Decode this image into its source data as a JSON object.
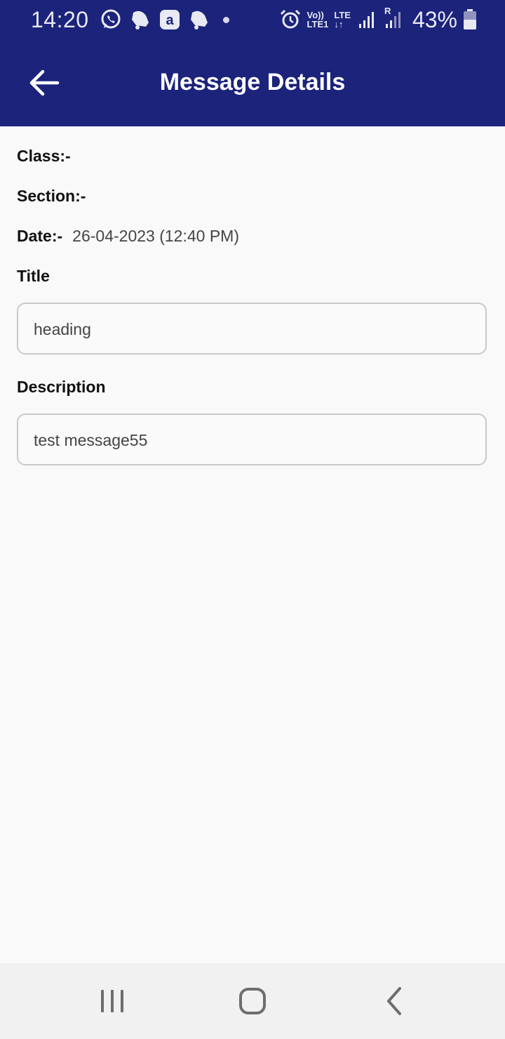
{
  "status_bar": {
    "time": "14:20",
    "volte_label": "Vo))",
    "lte1_label": "LTE1",
    "lte_label": "LTE",
    "roaming_label": "R",
    "battery": "43%"
  },
  "app_bar": {
    "title": "Message Details",
    "back_icon": "arrow-left-icon",
    "background": "#1b237b"
  },
  "details": {
    "class_label": "Class:-",
    "class_value": "",
    "section_label": "Section:-",
    "section_value": "",
    "date_label": "Date:-",
    "date_value": "26-04-2023 (12:40 PM)",
    "title_label": "Title",
    "title_value": "heading",
    "description_label": "Description",
    "description_value": "test message55"
  },
  "nav_bar": {
    "recents_icon": "recents-icon",
    "home_icon": "home-icon",
    "back_icon": "back-chevron-icon"
  }
}
